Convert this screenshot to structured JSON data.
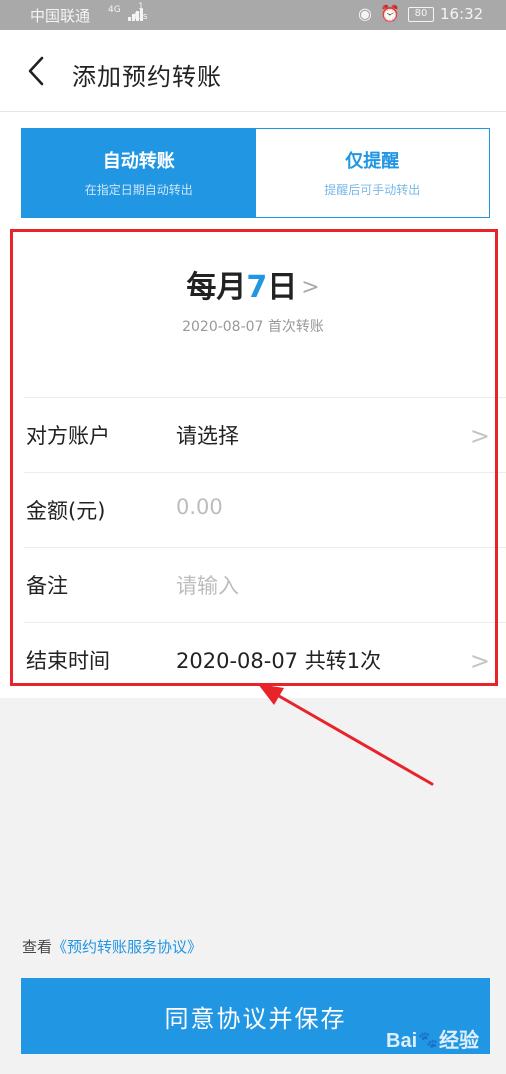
{
  "status_bar": {
    "carrier": "中国联通",
    "network": "4G",
    "speed_value": "1",
    "speed_unit": "K/s",
    "battery": "80",
    "time": "16:32"
  },
  "header": {
    "title": "添加预约转账"
  },
  "modes": [
    {
      "title": "自动转账",
      "subtitle": "在指定日期自动转出"
    },
    {
      "title": "仅提醒",
      "subtitle": "提醒后可手动转出"
    }
  ],
  "schedule": {
    "prefix": "每月",
    "day": "7",
    "suffix": "日",
    "first_transfer": "2020-08-07 首次转账"
  },
  "form": {
    "account_label": "对方账户",
    "account_value": "请选择",
    "amount_label": "金额(元)",
    "amount_placeholder": "0.00",
    "remark_label": "备注",
    "remark_placeholder": "请输入",
    "end_label": "结束时间",
    "end_value": "2020-08-07 共转1次"
  },
  "agreement": {
    "prefix": "查看",
    "link": "《预约转账服务协议》"
  },
  "save_button": "同意协议并保存",
  "watermark": {
    "left": "Bai",
    "right": "经验"
  },
  "colors": {
    "accent": "#2196e3",
    "annotation": "#e8232a"
  }
}
